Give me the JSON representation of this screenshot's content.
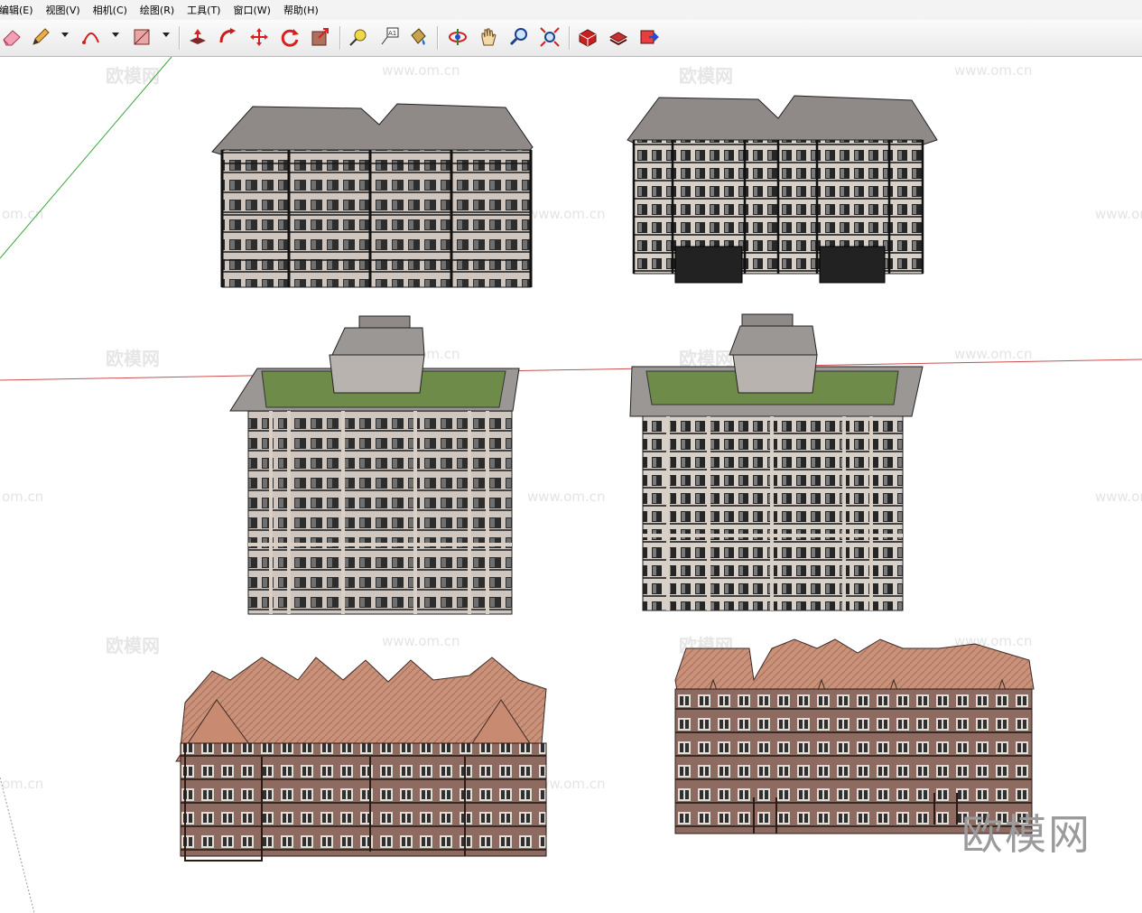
{
  "menu": [
    "编辑(E)",
    "视图(V)",
    "相机(C)",
    "绘图(R)",
    "工具(T)",
    "窗口(W)",
    "帮助(H)"
  ],
  "toolbar": {
    "icons": [
      "eraser-icon",
      "pencil-icon",
      "arc-icon",
      "rectangle-icon",
      "push-pull-icon",
      "follow-me-icon",
      "move-icon",
      "rotate-icon",
      "offset-icon",
      "tape-measure-icon",
      "text-label-icon",
      "paint-bucket-icon",
      "orbit-icon",
      "pan-icon",
      "zoom-icon",
      "zoom-extents-icon",
      "model-gallery-icon",
      "component-icon",
      "share-model-icon"
    ],
    "text_tool_label": "A1"
  },
  "watermarks": {
    "logo_text": "欧模网",
    "url_text": "www.om.cn",
    "url_fragment": "om.cn",
    "brand": "欧模网"
  }
}
